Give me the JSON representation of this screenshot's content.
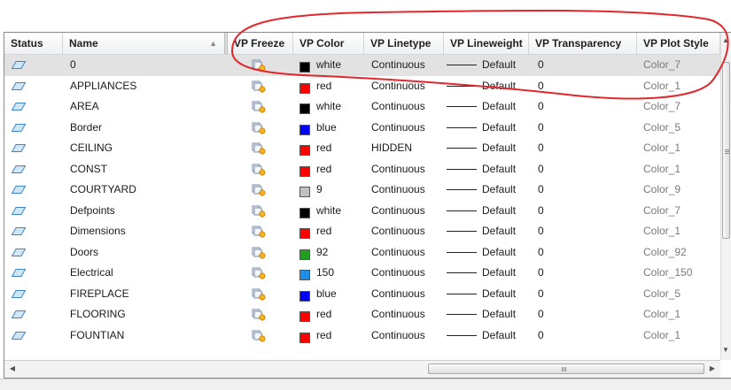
{
  "columns": [
    {
      "label": "Status"
    },
    {
      "label": "Name"
    },
    {
      "label": "VP Freeze"
    },
    {
      "label": "VP Color"
    },
    {
      "label": "VP Linetype"
    },
    {
      "label": "VP Lineweight"
    },
    {
      "label": "VP Transparency"
    },
    {
      "label": "VP Plot Style"
    }
  ],
  "sort_indicator": "▲",
  "rows": [
    {
      "name": "0",
      "color": "white",
      "color_hex": "#000000",
      "linetype": "Continuous",
      "lineweight": "Default",
      "transparency": "0",
      "plot_style": "Color_7",
      "selected": true
    },
    {
      "name": "APPLIANCES",
      "color": "red",
      "color_hex": "#ff0000",
      "linetype": "Continuous",
      "lineweight": "Default",
      "transparency": "0",
      "plot_style": "Color_1"
    },
    {
      "name": "AREA",
      "color": "white",
      "color_hex": "#000000",
      "linetype": "Continuous",
      "lineweight": "Default",
      "transparency": "0",
      "plot_style": "Color_7"
    },
    {
      "name": "Border",
      "color": "blue",
      "color_hex": "#0000ff",
      "linetype": "Continuous",
      "lineweight": "Default",
      "transparency": "0",
      "plot_style": "Color_5"
    },
    {
      "name": "CEILING",
      "color": "red",
      "color_hex": "#ff0000",
      "linetype": "HIDDEN",
      "lineweight": "Default",
      "transparency": "0",
      "plot_style": "Color_1"
    },
    {
      "name": "CONST",
      "color": "red",
      "color_hex": "#ff0000",
      "linetype": "Continuous",
      "lineweight": "Default",
      "transparency": "0",
      "plot_style": "Color_1"
    },
    {
      "name": "COURTYARD",
      "color": "9",
      "color_hex": "#c0c0c0",
      "linetype": "Continuous",
      "lineweight": "Default",
      "transparency": "0",
      "plot_style": "Color_9"
    },
    {
      "name": "Defpoints",
      "color": "white",
      "color_hex": "#000000",
      "linetype": "Continuous",
      "lineweight": "Default",
      "transparency": "0",
      "plot_style": "Color_7"
    },
    {
      "name": "Dimensions",
      "color": "red",
      "color_hex": "#ff0000",
      "linetype": "Continuous",
      "lineweight": "Default",
      "transparency": "0",
      "plot_style": "Color_1"
    },
    {
      "name": "Doors",
      "color": "92",
      "color_hex": "#1f9f1f",
      "linetype": "Continuous",
      "lineweight": "Default",
      "transparency": "0",
      "plot_style": "Color_92"
    },
    {
      "name": "Electrical",
      "color": "150",
      "color_hex": "#1e8fe6",
      "linetype": "Continuous",
      "lineweight": "Default",
      "transparency": "0",
      "plot_style": "Color_150"
    },
    {
      "name": "FIREPLACE",
      "color": "blue",
      "color_hex": "#0000ff",
      "linetype": "Continuous",
      "lineweight": "Default",
      "transparency": "0",
      "plot_style": "Color_5"
    },
    {
      "name": "FLOORING",
      "color": "red",
      "color_hex": "#ff0000",
      "linetype": "Continuous",
      "lineweight": "Default",
      "transparency": "0",
      "plot_style": "Color_1"
    },
    {
      "name": "FOUNTIAN",
      "color": "red",
      "color_hex": "#ff0000",
      "linetype": "Continuous",
      "lineweight": "Default",
      "transparency": "0",
      "plot_style": "Color_1"
    }
  ],
  "icons": {
    "status": "layer-status-icon",
    "freeze": "vp-freeze-sun-icon",
    "scroll_up": "arrow-up-icon",
    "scroll_down": "arrow-down-icon",
    "scroll_left": "arrow-left-icon",
    "scroll_right": "arrow-right-icon"
  },
  "scrollbars": {
    "up": "▲",
    "down": "▼",
    "left": "◀",
    "right": "▶"
  },
  "annotation_color": "#e0282d",
  "selected_row_color": "#e2e2e2"
}
